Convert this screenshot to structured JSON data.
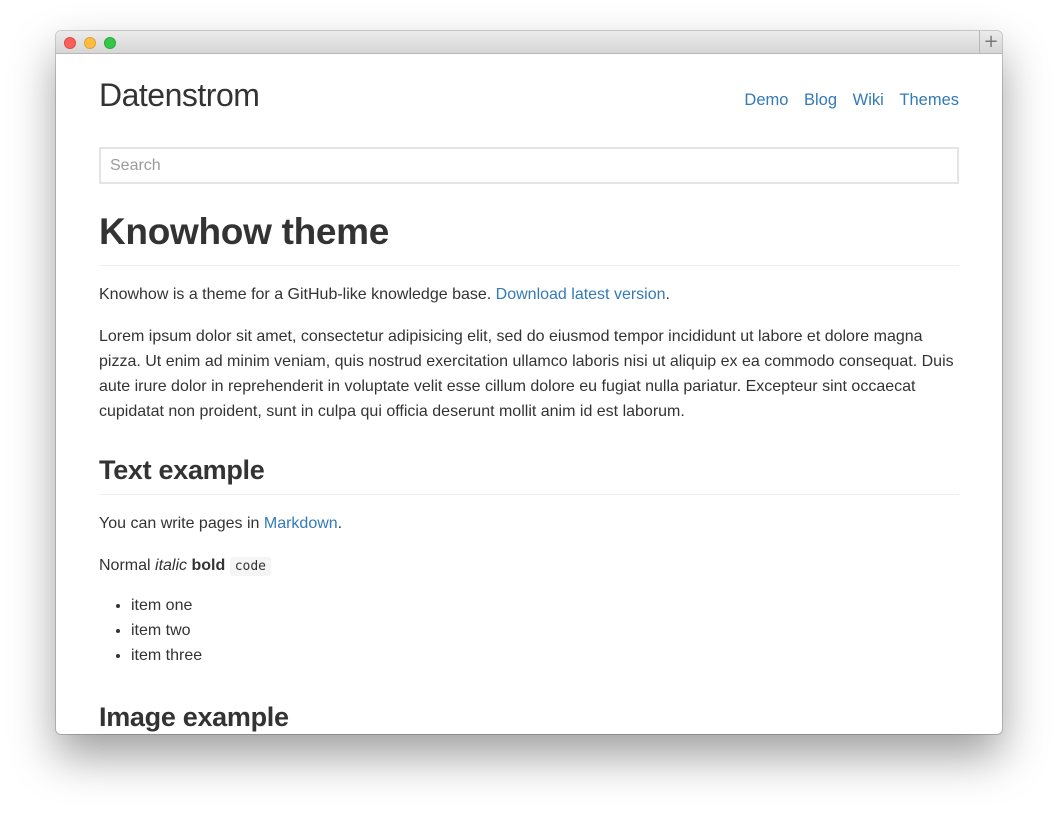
{
  "window": {
    "new_tab_label": "+"
  },
  "header": {
    "site_title": "Datenstrom",
    "nav": [
      "Demo",
      "Blog",
      "Wiki",
      "Themes"
    ]
  },
  "search": {
    "placeholder": "Search",
    "value": ""
  },
  "page": {
    "title": "Knowhow theme",
    "intro_text": "Knowhow is a theme for a GitHub-like knowledge base.",
    "intro_link": "Download latest version",
    "intro_end": ".",
    "lorem": "Lorem ipsum dolor sit amet, consectetur adipisicing elit, sed do eiusmod tempor incididunt ut labore et dolore magna pizza. Ut enim ad minim veniam, quis nostrud exercitation ullamco laboris nisi ut aliquip ex ea commodo consequat. Duis aute irure dolor in reprehenderit in voluptate velit esse cillum dolore eu fugiat nulla pariatur. Excepteur sint occaecat cupidatat non proident, sunt in culpa qui officia deserunt mollit anim id est laborum."
  },
  "text_example": {
    "heading": "Text example",
    "write_text": "You can write pages in",
    "write_link": "Markdown",
    "write_end": ".",
    "normal": "Normal",
    "italic": "italic",
    "bold": "bold",
    "code": "code",
    "items": [
      "item one",
      "item two",
      "item three"
    ]
  },
  "image_example": {
    "heading": "Image example"
  },
  "colors": {
    "link": "#337ab7",
    "text": "#333333",
    "close": "#fc605b",
    "minimize": "#fdbc40",
    "maximize": "#34c84a"
  }
}
